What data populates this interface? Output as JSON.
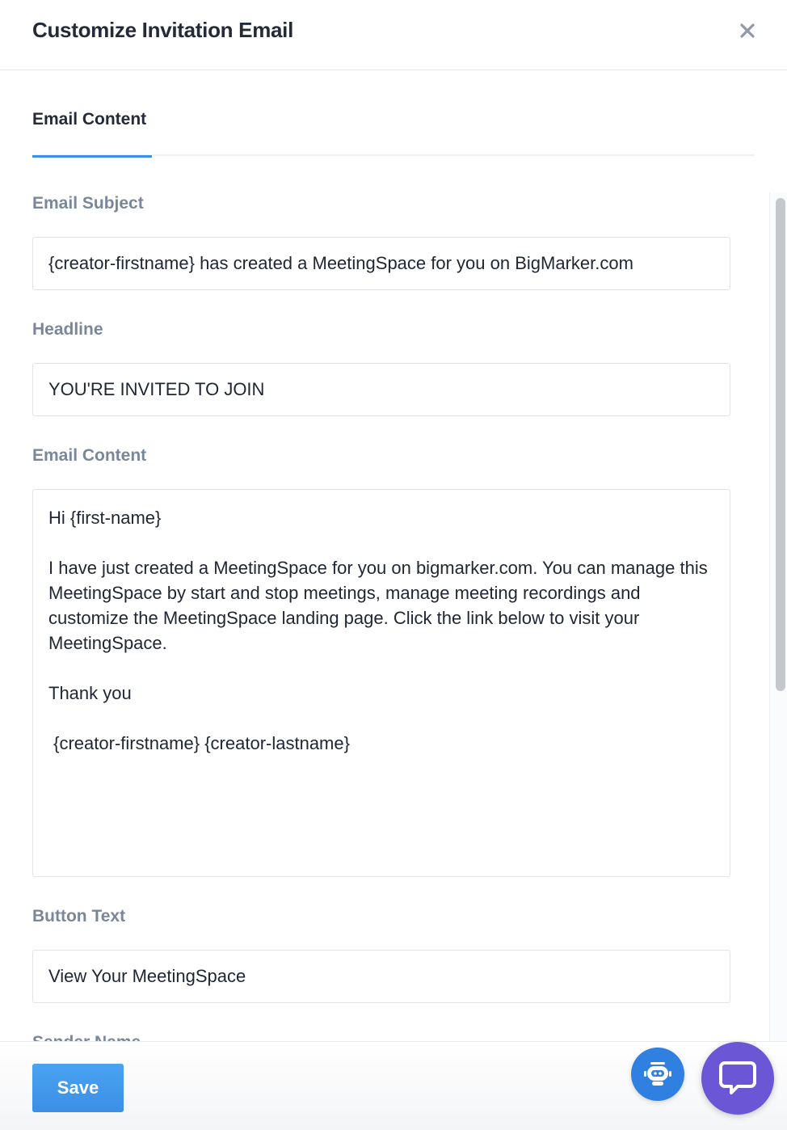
{
  "header": {
    "title": "Customize Invitation Email",
    "close_icon": "close-icon"
  },
  "tabs": [
    {
      "label": "Email Content",
      "active": true
    }
  ],
  "form": {
    "subject_label": "Email Subject",
    "subject_value": "{creator-firstname} has created a MeetingSpace for you on BigMarker.com",
    "headline_label": "Headline",
    "headline_value": "YOU'RE INVITED TO JOIN",
    "content_label": "Email Content",
    "content_value": "Hi {first-name}\n\nI have just created a MeetingSpace for you on bigmarker.com. You can manage this MeetingSpace by start and stop meetings, manage meeting recordings and customize the MeetingSpace landing page. Click the link below to visit your MeetingSpace.\n\nThank you\n\n {creator-firstname} {creator-lastname}",
    "button_text_label": "Button Text",
    "button_text_value": "View Your MeetingSpace",
    "sender_name_label": "Sender Name"
  },
  "footer": {
    "save_label": "Save",
    "bot_icon": "robot-icon",
    "chat_icon": "chat-bubble-icon"
  },
  "colors": {
    "accent": "#3d8ee6",
    "label": "#7a879b",
    "chat": "#6b57d6"
  }
}
